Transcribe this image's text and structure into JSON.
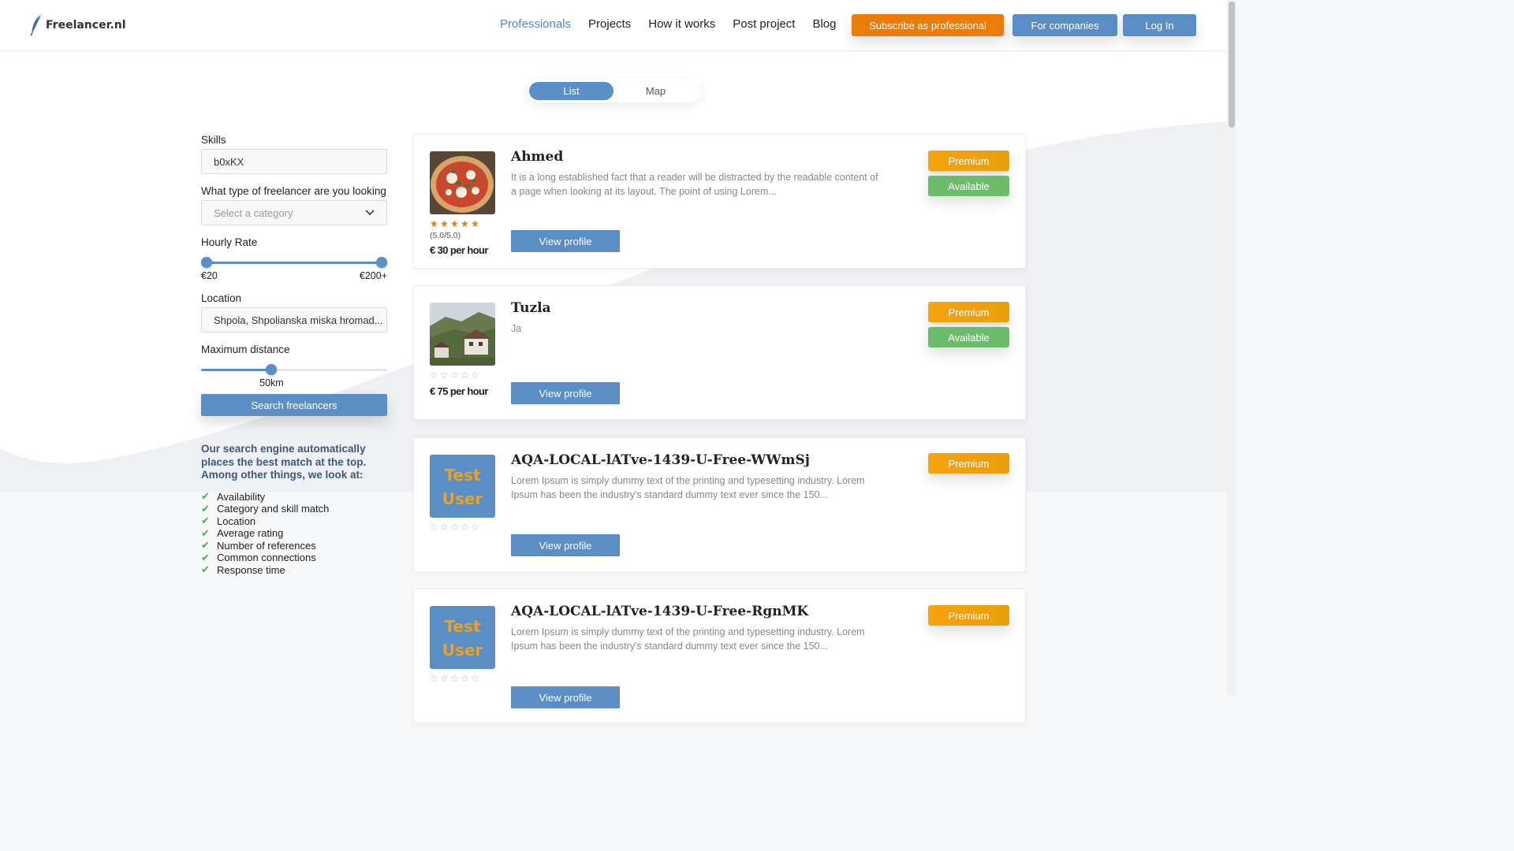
{
  "header": {
    "logo_text": "Freelancer.nl",
    "nav": [
      "Professionals",
      "Projects",
      "How it works",
      "Post project",
      "Blog"
    ],
    "subscribe_label": "Subscribe as professional",
    "companies_label": "For companies",
    "login_label": "Log In"
  },
  "view_toggle": {
    "list_label": "List",
    "map_label": "Map",
    "selected": "List"
  },
  "filters": {
    "skills_label": "Skills",
    "skills_value": "b0xKX",
    "type_label": "What type of freelancer are you looking",
    "type_placeholder": "Select a category",
    "rate_label": "Hourly Rate",
    "rate_min": "€20",
    "rate_max": "€200+",
    "location_label": "Location",
    "location_value": "Shpola, Shpolianska miska hromad...",
    "distance_label": "Maximum distance",
    "distance_value": "50km",
    "distance_fraction": 0.37,
    "search_label": "Search freelancers"
  },
  "info": {
    "title": "Our search engine automatically places the best match at the top. Among other things, we look at:",
    "items": [
      "Availability",
      "Category and skill match",
      "Location",
      "Average rating",
      "Number of references",
      "Common connections",
      "Response time"
    ]
  },
  "freelancers": [
    {
      "name": "Ahmed",
      "description": "It is a long established fact that a reader will be distracted by the readable content of a page when looking at its layout. The point of using Lorem...",
      "rating_text": "(5.0/5.0)",
      "rating": 5,
      "rate": "€ 30 per hour",
      "premium": "Premium",
      "available": "Available",
      "view_label": "View profile"
    },
    {
      "name": "Tuzla",
      "description": "Ja",
      "rating": 0,
      "rate": "€ 75 per hour",
      "premium": "Premium",
      "available": "Available",
      "view_label": "View profile"
    },
    {
      "name": "AQA-LOCAL-lATve-1439-U-Free-WWmSj",
      "description": "Lorem Ipsum is simply dummy text of the printing and typesetting industry. Lorem Ipsum has been the industry's standard dummy text ever since the 150...",
      "rating": 0,
      "placeholder_text": [
        "Test",
        "User"
      ],
      "premium": "Premium",
      "view_label": "View profile"
    },
    {
      "name": "AQA-LOCAL-lATve-1439-U-Free-RgnMK",
      "description": "Lorem Ipsum is simply dummy text of the printing and typesetting industry. Lorem Ipsum has been the industry's standard dummy text ever since the 150...",
      "rating": 0,
      "placeholder_text": [
        "Test",
        "User"
      ],
      "premium": "Premium",
      "view_label": "View profile"
    }
  ],
  "colors": {
    "accent": "#5b8ec4",
    "orange": "#ec7c0a",
    "premium": "#f4a10d",
    "available": "#6bbd6b"
  }
}
